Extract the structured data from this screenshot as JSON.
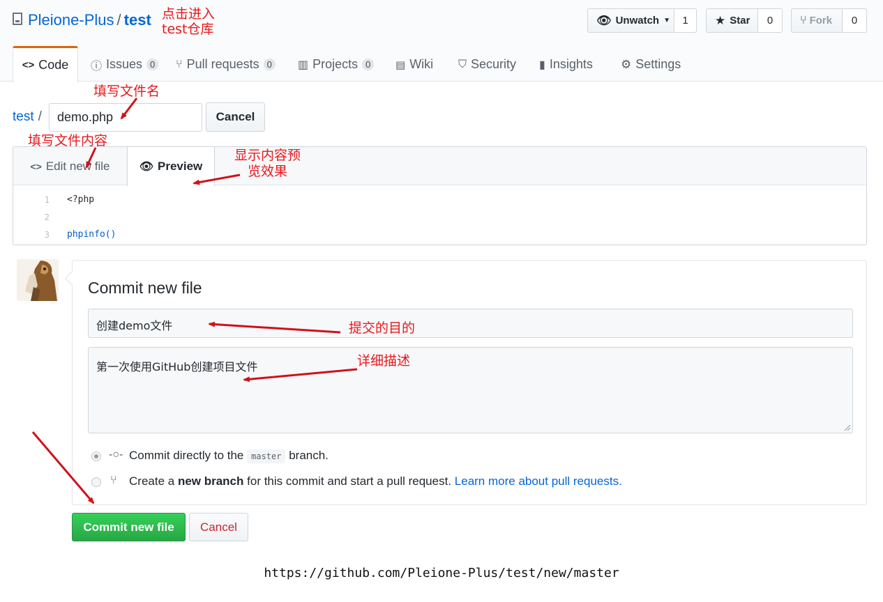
{
  "repo": {
    "owner": "Pleione-Plus",
    "separator": "/",
    "name": "test"
  },
  "header_buttons": {
    "watch": {
      "label": "Unwatch",
      "count": "1"
    },
    "star": {
      "label": "Star",
      "count": "0"
    },
    "fork": {
      "label": "Fork",
      "count": "0"
    }
  },
  "tabs": [
    {
      "label": "Code"
    },
    {
      "label": "Issues",
      "count": "0"
    },
    {
      "label": "Pull requests",
      "count": "0"
    },
    {
      "label": "Projects",
      "count": "0"
    },
    {
      "label": "Wiki"
    },
    {
      "label": "Security"
    },
    {
      "label": "Insights"
    },
    {
      "label": "Settings"
    }
  ],
  "file": {
    "breadcrumb_root": "test",
    "breadcrumb_sep": "/",
    "filename_value": "demo.php",
    "cancel_label": "Cancel"
  },
  "editor": {
    "tab_edit": "Edit new file",
    "tab_preview": "Preview",
    "line_numbers": [
      "1",
      "2",
      "3"
    ],
    "lines": [
      "<?php",
      "",
      "phpinfo()"
    ]
  },
  "commit": {
    "title": "Commit new file",
    "summary_value": "创建demo文件",
    "description_value": "第一次使用GitHub创建项目文件",
    "option_direct_prefix": "Commit directly to the",
    "option_direct_branch": "master",
    "option_direct_suffix": "branch.",
    "option_new_prefix": "Create a",
    "option_new_bold": "new branch",
    "option_new_suffix": "for this commit and start a pull request.",
    "option_new_link": "Learn more about pull requests.",
    "submit_label": "Commit new file",
    "cancel_label": "Cancel"
  },
  "annotations": {
    "enter_repo_line1": "点击进入",
    "enter_repo_line2": "test仓库",
    "fill_filename": "填写文件名",
    "fill_content": "填写文件内容",
    "preview_line1": "显示内容预",
    "preview_line2": "览效果",
    "commit_purpose": "提交的目的",
    "detail_desc": "详细描述"
  },
  "caption_url": "https://github.com/Pleione-Plus/test/new/master",
  "colors": {
    "link": "#0366d6",
    "annotation": "#e8171b",
    "commit_button": "#28a745",
    "active_tab_border": "#e36209"
  }
}
